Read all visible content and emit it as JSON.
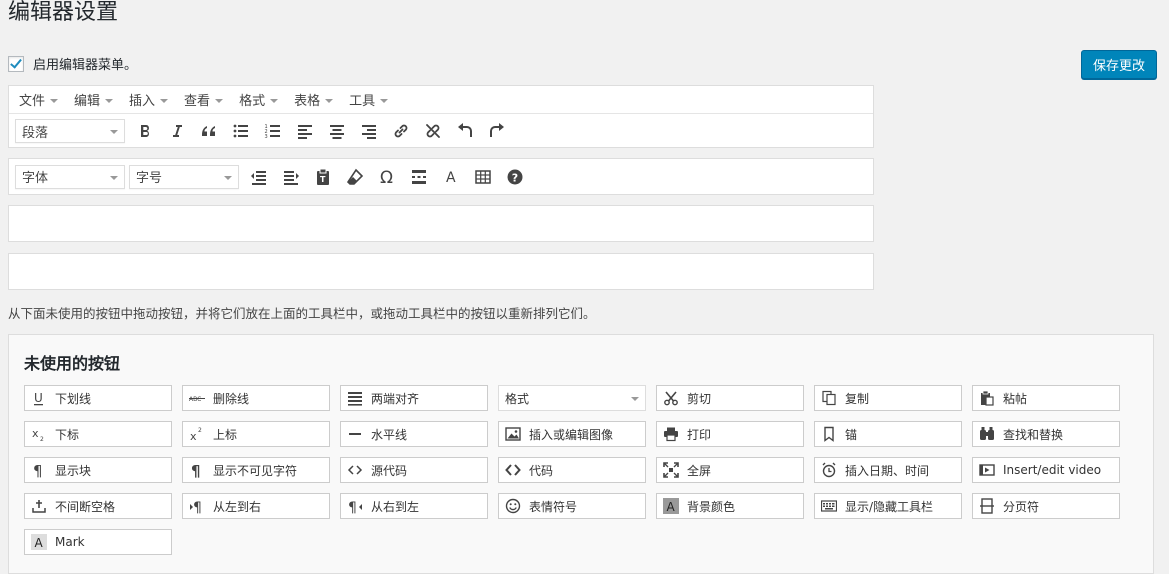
{
  "page_title": "编辑器设置",
  "enable_menu": {
    "label": "启用编辑器菜单。",
    "checked": true
  },
  "save_button": "保存更改",
  "menubar": [
    "文件",
    "编辑",
    "插入",
    "查看",
    "格式",
    "表格",
    "工具"
  ],
  "toolbar1": {
    "format_select": "段落",
    "buttons": [
      "bold",
      "italic",
      "blockquote",
      "bullet-list",
      "numbered-list",
      "align-left",
      "align-center",
      "align-right",
      "link",
      "unlink",
      "undo",
      "redo"
    ]
  },
  "toolbar2": {
    "font_select": "字体",
    "size_select": "字号",
    "buttons": [
      "outdent",
      "indent",
      "paste-text",
      "clear-formatting",
      "special-character",
      "horizontal-more",
      "text-color",
      "table",
      "help"
    ]
  },
  "hint": "从下面未使用的按钮中拖动按钮，并将它们放在上面的工具栏中，或拖动工具栏中的按钮以重新排列它们。",
  "unused": {
    "title": "未使用的按钮",
    "rows": [
      [
        {
          "label": "下划线",
          "icon": "underline-icon"
        },
        {
          "label": "删除线",
          "icon": "strikethrough-icon"
        },
        {
          "label": "两端对齐",
          "icon": "align-justify-icon"
        },
        {
          "label": "格式",
          "icon": "format-select"
        },
        {
          "label": "剪切",
          "icon": "cut-icon"
        },
        {
          "label": "复制",
          "icon": "copy-icon"
        },
        {
          "label": "粘帖",
          "icon": "paste-icon"
        }
      ],
      [
        {
          "label": "下标",
          "icon": "subscript-icon"
        },
        {
          "label": "上标",
          "icon": "superscript-icon"
        },
        {
          "label": "水平线",
          "icon": "horizontal-line-icon"
        },
        {
          "label": "插入或编辑图像",
          "icon": "image-icon"
        },
        {
          "label": "打印",
          "icon": "print-icon"
        },
        {
          "label": "锚",
          "icon": "anchor-icon"
        },
        {
          "label": "查找和替换",
          "icon": "find-replace-icon"
        }
      ],
      [
        {
          "label": "显示块",
          "icon": "pilcrow-icon"
        },
        {
          "label": "显示不可见字符",
          "icon": "invisible-chars-icon"
        },
        {
          "label": "源代码",
          "icon": "source-code-icon"
        },
        {
          "label": "代码",
          "icon": "code-icon"
        },
        {
          "label": "全屏",
          "icon": "fullscreen-icon"
        },
        {
          "label": "插入日期、时间",
          "icon": "clock-icon"
        },
        {
          "label": "Insert/edit video",
          "icon": "video-icon"
        }
      ],
      [
        {
          "label": "不间断空格",
          "icon": "nbsp-icon"
        },
        {
          "label": "从左到右",
          "icon": "ltr-icon"
        },
        {
          "label": "从右到左",
          "icon": "rtl-icon"
        },
        {
          "label": "表情符号",
          "icon": "emoticon-icon"
        },
        {
          "label": "背景颜色",
          "icon": "background-color-icon"
        },
        {
          "label": "显示/隐藏工具栏",
          "icon": "keyboard-icon"
        },
        {
          "label": "分页符",
          "icon": "page-break-icon"
        }
      ],
      [
        {
          "label": "Mark",
          "icon": "mark-icon"
        }
      ]
    ]
  }
}
